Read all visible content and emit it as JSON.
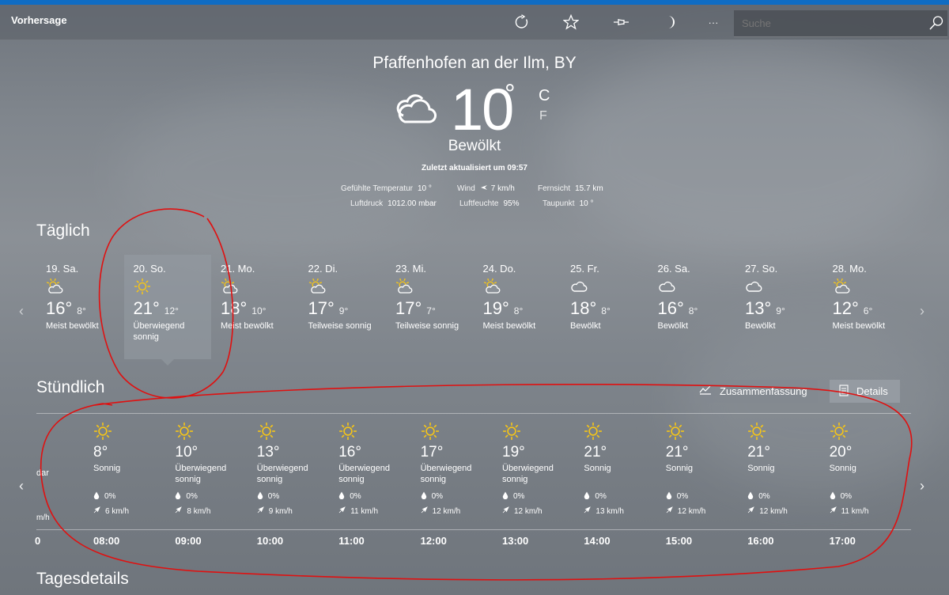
{
  "app": {
    "title": "Vorhersage"
  },
  "toolbar": {
    "more_label": "···"
  },
  "search": {
    "placeholder": "Suche"
  },
  "current": {
    "location": "Pfaffenhofen an der Ilm, BY",
    "temperature": "10",
    "degree": "°",
    "unit_c": "C",
    "unit_f": "F",
    "condition": "Bewölkt",
    "updated": "Zuletzt aktualisiert um 09:57",
    "metrics_row1": [
      {
        "label": "Gefühlte Temperatur",
        "value": "10 °"
      },
      {
        "label": "Wind",
        "value": "7 km/h"
      },
      {
        "label": "Fernsicht",
        "value": "15.7 km"
      }
    ],
    "metrics_row2": [
      {
        "label": "Luftdruck",
        "value": "1012.00 mbar"
      },
      {
        "label": "Luftfeuchte",
        "value": "95%"
      },
      {
        "label": "Taupunkt",
        "value": "10 °"
      }
    ]
  },
  "daily": {
    "title": "Täglich",
    "selected_index": 1,
    "days": [
      {
        "date": "19. Sa.",
        "icon": "partly-sunny-icon",
        "high": "16°",
        "low": "8°",
        "desc": "Meist bewölkt"
      },
      {
        "date": "20. So.",
        "icon": "sun-icon",
        "high": "21°",
        "low": "12°",
        "desc": "Überwiegend sonnig"
      },
      {
        "date": "21. Mo.",
        "icon": "partly-sunny-icon",
        "high": "18°",
        "low": "10°",
        "desc": "Meist bewölkt"
      },
      {
        "date": "22. Di.",
        "icon": "partly-sunny-icon",
        "high": "17°",
        "low": "9°",
        "desc": "Teilweise sonnig"
      },
      {
        "date": "23. Mi.",
        "icon": "partly-sunny-icon",
        "high": "17°",
        "low": "7°",
        "desc": "Teilweise sonnig"
      },
      {
        "date": "24. Do.",
        "icon": "partly-sunny-icon",
        "high": "19°",
        "low": "8°",
        "desc": "Meist bewölkt"
      },
      {
        "date": "25. Fr.",
        "icon": "cloud-icon",
        "high": "18°",
        "low": "8°",
        "desc": "Bewölkt"
      },
      {
        "date": "26. Sa.",
        "icon": "cloud-icon",
        "high": "16°",
        "low": "8°",
        "desc": "Bewölkt"
      },
      {
        "date": "27. So.",
        "icon": "cloud-icon",
        "high": "13°",
        "low": "9°",
        "desc": "Bewölkt"
      },
      {
        "date": "28. Mo.",
        "icon": "partly-sunny-icon",
        "high": "12°",
        "low": "6°",
        "desc": "Meist bewölkt"
      }
    ]
  },
  "hourly": {
    "title": "Stündlich",
    "tab_summary": "Zusammenfassung",
    "tab_details": "Details",
    "partial_left": {
      "desc": "dar",
      "wind": "m/h",
      "time": "0"
    },
    "hours": [
      {
        "icon": "sun-icon",
        "temp": "8°",
        "desc": "Sonnig",
        "precip": "0%",
        "wind": "6 km/h",
        "time": "08:00"
      },
      {
        "icon": "sun-icon",
        "temp": "10°",
        "desc": "Überwiegend sonnig",
        "precip": "0%",
        "wind": "8 km/h",
        "time": "09:00"
      },
      {
        "icon": "sun-icon",
        "temp": "13°",
        "desc": "Überwiegend sonnig",
        "precip": "0%",
        "wind": "9 km/h",
        "time": "10:00"
      },
      {
        "icon": "sun-icon",
        "temp": "16°",
        "desc": "Überwiegend sonnig",
        "precip": "0%",
        "wind": "11 km/h",
        "time": "11:00"
      },
      {
        "icon": "sun-icon",
        "temp": "17°",
        "desc": "Überwiegend sonnig",
        "precip": "0%",
        "wind": "12 km/h",
        "time": "12:00"
      },
      {
        "icon": "sun-icon",
        "temp": "19°",
        "desc": "Überwiegend sonnig",
        "precip": "0%",
        "wind": "12 km/h",
        "time": "13:00"
      },
      {
        "icon": "sun-icon",
        "temp": "21°",
        "desc": "Sonnig",
        "precip": "0%",
        "wind": "13 km/h",
        "time": "14:00"
      },
      {
        "icon": "sun-icon",
        "temp": "21°",
        "desc": "Sonnig",
        "precip": "0%",
        "wind": "12 km/h",
        "time": "15:00"
      },
      {
        "icon": "sun-icon",
        "temp": "21°",
        "desc": "Sonnig",
        "precip": "0%",
        "wind": "12 km/h",
        "time": "16:00"
      },
      {
        "icon": "sun-icon",
        "temp": "20°",
        "desc": "Sonnig",
        "precip": "0%",
        "wind": "11 km/h",
        "time": "17:00"
      }
    ]
  },
  "tagesdetails": {
    "title": "Tagesdetails"
  },
  "colors": {
    "accent": "#0f6cc3",
    "sun": "#f5c518",
    "annotation": "#e01010"
  }
}
